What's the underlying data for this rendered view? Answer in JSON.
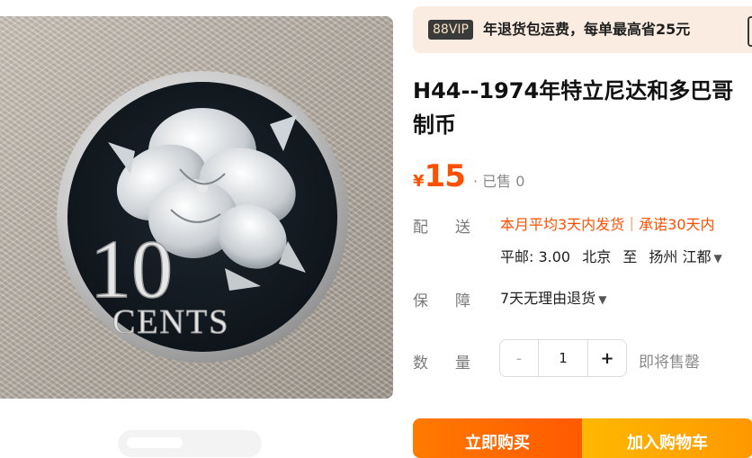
{
  "vip_banner": {
    "badge": "88VIP",
    "text": "年退货包运费，每单最高省25元"
  },
  "product": {
    "title_line1": "H44--1974年特立尼达和多巴哥",
    "title_line2": "制币",
    "currency": "¥",
    "price": "15",
    "sold_text": "· 已售 0",
    "coin_denomination": "10",
    "coin_unit": "CENTS"
  },
  "shipping": {
    "label": "配送",
    "promise": "本月平均3天内发货｜承诺30天内",
    "postage": "平邮: 3.00",
    "from": "北京",
    "to_word": "至",
    "destination": "扬州 江都"
  },
  "guarantee": {
    "label": "保障",
    "text": "7天无理由退货"
  },
  "quantity": {
    "label": "数量",
    "minus": "-",
    "value": "1",
    "plus": "+",
    "stock_status": "即将售罄"
  },
  "actions": {
    "buy_now": "立即购买",
    "add_to_cart": "加入购物车"
  },
  "colors": {
    "accent": "#ff5000",
    "vip_banner_bg": "#fbece1"
  }
}
